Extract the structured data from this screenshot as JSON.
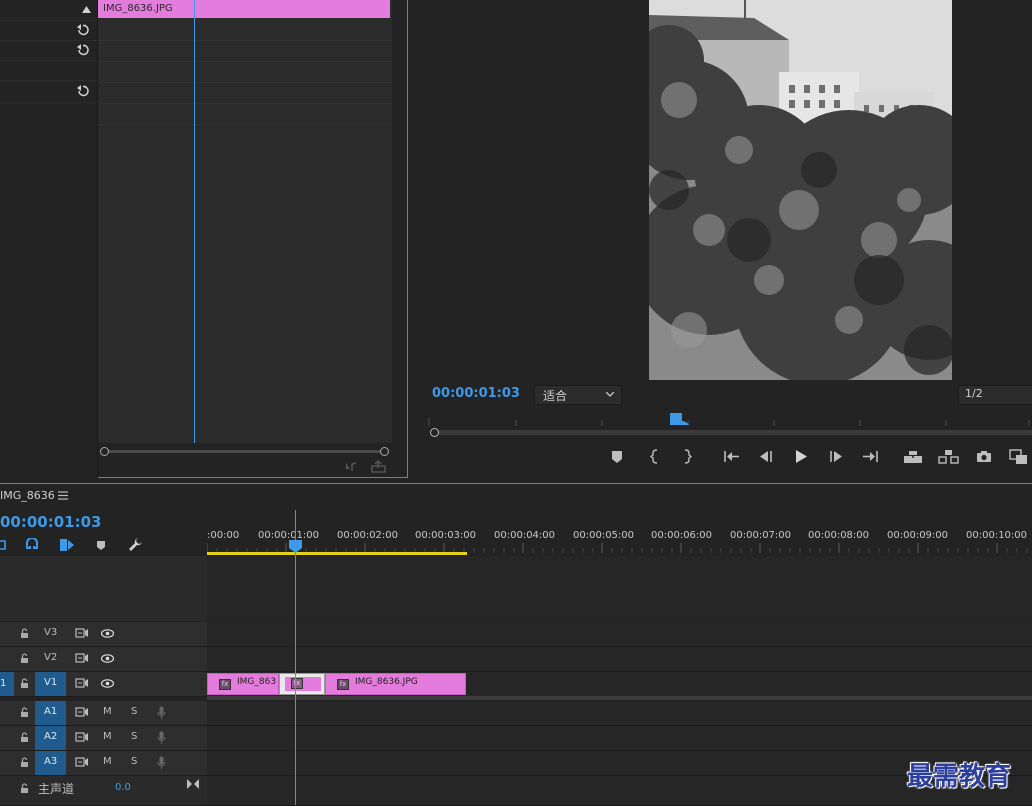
{
  "effect_controls": {
    "clip_name": "IMG_8636.JPG",
    "reset_icon": "reset-icon"
  },
  "program_monitor": {
    "timecode": "00:00:01:03",
    "fit_label": "适合",
    "resolution": "1/2",
    "controls": [
      "add-marker-icon",
      "mark-in-icon",
      "mark-out-icon",
      "go-to-in-icon",
      "step-back-icon",
      "play-icon",
      "step-forward-icon",
      "go-to-out-icon",
      "lift-icon",
      "extract-icon",
      "export-frame-icon",
      "compare-icon"
    ]
  },
  "timeline": {
    "sequence_name": "IMG_8636",
    "timecode": "00:00:01:03",
    "ruler_labels": [
      ":00:00",
      "00:00:01:00",
      "00:00:02:00",
      "00:00:03:00",
      "00:00:04:00",
      "00:00:05:00",
      "00:00:06:00",
      "00:00:07:00",
      "00:00:08:00",
      "00:00:09:00",
      "00:00:10:00"
    ],
    "tracks": {
      "v3": "V3",
      "v2": "V2",
      "v1": "V1",
      "v1_source": "1",
      "a1": "A1",
      "a2": "A2",
      "a3": "A3",
      "mute": "M",
      "solo": "S",
      "master": "主声道",
      "master_value": "0.0"
    },
    "clips": {
      "clip1": "IMG_863",
      "clip3": "IMG_8636.JPG",
      "fx": "fx"
    }
  },
  "watermark": "最需教育",
  "colors": {
    "accent_blue": "#3d9ae8",
    "clip_pink": "#e37cdc",
    "work_area_yellow": "#e3d21a"
  }
}
